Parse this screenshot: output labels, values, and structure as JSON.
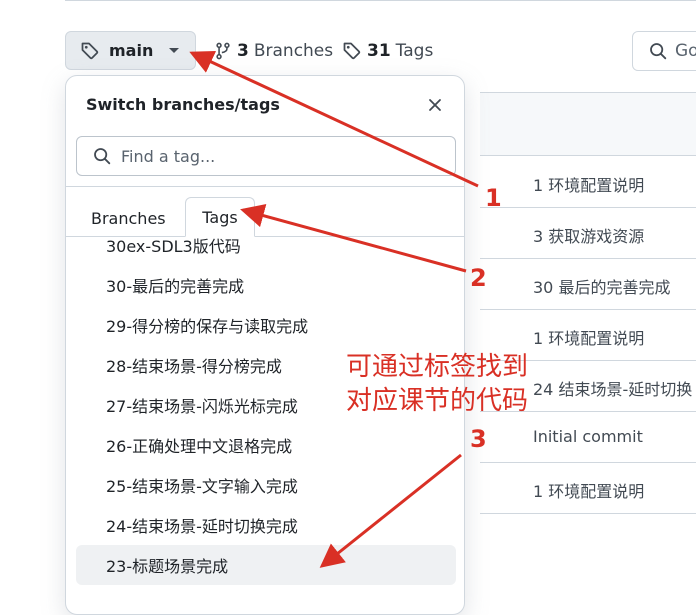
{
  "header": {
    "branch_button_label": "main",
    "branches_count": "3",
    "branches_label": "Branches",
    "tags_count": "31",
    "tags_label": "Tags",
    "search_text": "Go"
  },
  "file_rows": [
    "1 环境配置说明",
    "3 获取游戏资源",
    "30 最后的完善完成",
    "1 环境配置说明",
    "24 结束场景-延时切换",
    "Initial commit",
    "1 环境配置说明"
  ],
  "dropdown": {
    "title": "Switch branches/tags",
    "filter_placeholder": "Find a tag...",
    "tabs": [
      "Branches",
      "Tags"
    ],
    "active_tab": "Tags",
    "items": [
      "30ex-SDL3版代码",
      "30-最后的完善完成",
      "29-得分榜的保存与读取完成",
      "28-结束场景-得分榜完成",
      "27-结束场景-闪烁光标完成",
      "26-正确处理中文退格完成",
      "25-结束场景-文字输入完成",
      "24-结束场景-延时切换完成",
      "23-标题场景完成"
    ],
    "selected_item": "23-标题场景完成"
  },
  "annotations": {
    "num1": "1",
    "num2": "2",
    "num3": "3",
    "caption_line1": "可通过标签找到",
    "caption_line2": "对应课节的代码",
    "color": "#d93025"
  },
  "colors": {
    "border": "#d0d7de",
    "button_bg": "#e7ebef",
    "selected_bg": "#eff1f3",
    "annotation_red": "#d93025"
  }
}
